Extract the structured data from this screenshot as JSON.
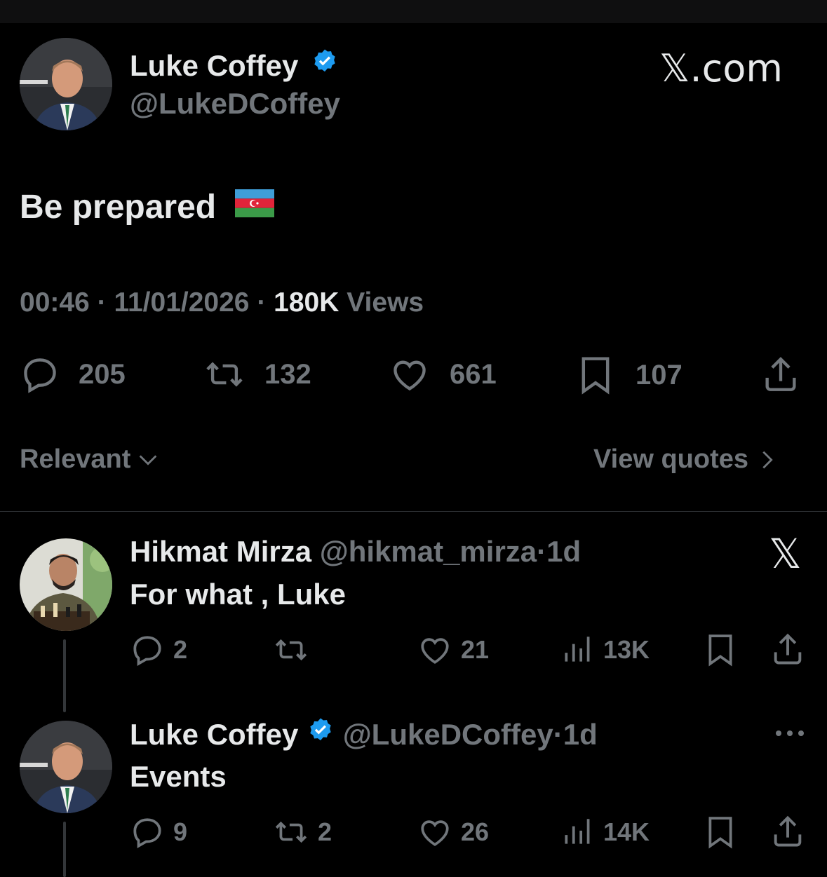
{
  "main_tweet": {
    "author_name": "Luke Coffey",
    "author_handle": "@LukeDCoffey",
    "brand": "𝕏.com",
    "text": "Be prepared",
    "time": "00:46",
    "date": "11/01/2026",
    "views_count": "180K",
    "views_label": "Views",
    "replies": "205",
    "reposts": "132",
    "likes": "661",
    "bookmarks": "107"
  },
  "sort": {
    "label": "Relevant",
    "view_quotes": "View quotes"
  },
  "replies": [
    {
      "author_name": "Hikmat Mirza",
      "author_handle": "@hikmat_mirza",
      "age": "1d",
      "text": "For what , Luke",
      "replies": "2",
      "reposts": "",
      "likes": "21",
      "views": "13K"
    },
    {
      "author_name": "Luke Coffey",
      "author_handle": "@LukeDCoffey",
      "age": "1d",
      "text": "Events",
      "replies": "9",
      "reposts": "2",
      "likes": "26",
      "views": "14K"
    }
  ],
  "colors": {
    "background": "#000000",
    "text": "#e7e9ea",
    "muted": "#71767b",
    "verified": "#1d9bf0",
    "divider": "#2f3336"
  }
}
